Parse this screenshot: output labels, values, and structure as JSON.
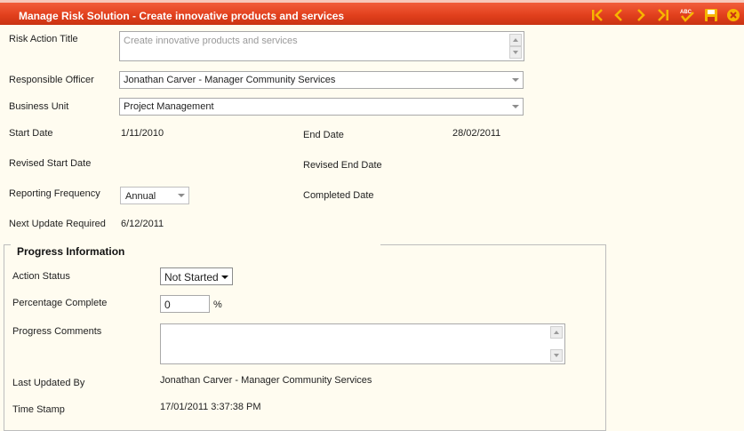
{
  "window": {
    "title": "Manage Risk Solution - Create innovative products and services",
    "toolbar": {
      "first": "first-record-icon",
      "previous": "previous-record-icon",
      "next": "next-record-icon",
      "last": "last-record-icon",
      "spellcheck": "spellcheck-icon",
      "spellcheck_text": "ABC",
      "save": "save-icon",
      "close": "close-icon"
    }
  },
  "form": {
    "risk_action_title": {
      "label": "Risk Action Title",
      "value": "Create innovative products and services"
    },
    "responsible_officer": {
      "label": "Responsible Officer",
      "value": "Jonathan Carver - Manager Community Services"
    },
    "business_unit": {
      "label": "Business Unit",
      "value": "Project Management"
    },
    "start_date": {
      "label": "Start Date",
      "value": "1/11/2010"
    },
    "end_date": {
      "label": "End Date",
      "value": "28/02/2011"
    },
    "revised_start_date": {
      "label": "Revised Start Date",
      "value": ""
    },
    "revised_end_date": {
      "label": "Revised End Date",
      "value": ""
    },
    "reporting_frequency": {
      "label": "Reporting Frequency",
      "value": "Annual"
    },
    "completed_date": {
      "label": "Completed Date",
      "value": ""
    },
    "next_update_required": {
      "label": "Next Update Required",
      "value": "6/12/2011"
    }
  },
  "progress": {
    "legend": "Progress Information",
    "action_status": {
      "label": "Action Status",
      "value": "Not Started"
    },
    "percentage_complete": {
      "label": "Percentage Complete",
      "value": "0",
      "unit": "%"
    },
    "progress_comments": {
      "label": "Progress Comments",
      "value": ""
    },
    "last_updated_by": {
      "label": "Last Updated By",
      "value": "Jonathan Carver - Manager Community Services"
    },
    "time_stamp": {
      "label": "Time Stamp",
      "value": "17/01/2011 3:37:38 PM"
    }
  },
  "colors": {
    "titlebar": "#E2401D",
    "toolbar_icon": "#F7B500",
    "background": "#FFFCF0"
  }
}
